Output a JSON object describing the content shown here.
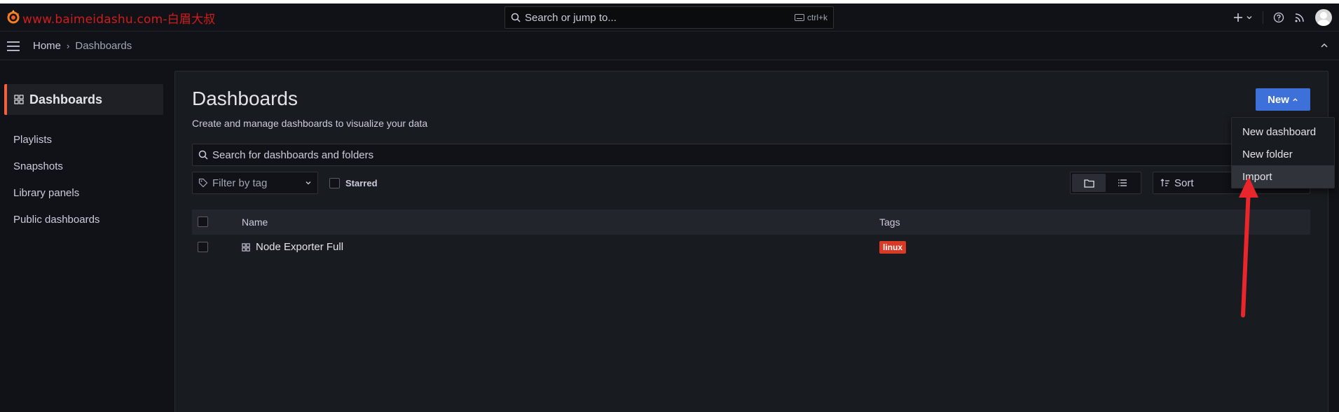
{
  "topbar": {
    "watermark": "www.baimeidashu.com-白眉大叔",
    "search_placeholder": "Search or jump to...",
    "search_shortcut": "ctrl+k",
    "icons": [
      "plus-icon",
      "help-icon",
      "news-rss-icon",
      "user-avatar"
    ]
  },
  "breadcrumb": {
    "home": "Home",
    "separator": "›",
    "current": "Dashboards"
  },
  "sidebar": {
    "active": "Dashboards",
    "items": [
      {
        "label": "Playlists"
      },
      {
        "label": "Snapshots"
      },
      {
        "label": "Library panels"
      },
      {
        "label": "Public dashboards"
      }
    ]
  },
  "page": {
    "title": "Dashboards",
    "subtitle": "Create and manage dashboards to visualize your data",
    "new_button": "New",
    "search_placeholder": "Search for dashboards and folders",
    "filter_placeholder": "Filter by tag",
    "starred_label": "Starred",
    "sort_placeholder": "Sort"
  },
  "table": {
    "columns": [
      "Name",
      "Tags"
    ],
    "rows": [
      {
        "name": "Node Exporter Full",
        "tag": "linux"
      }
    ]
  },
  "new_menu": {
    "items": [
      "New dashboard",
      "New folder",
      "Import"
    ],
    "hovered": "Import"
  },
  "colors": {
    "accent": "#3d71d9",
    "active_bar": "#f55f3e",
    "tag": "#d93a26",
    "arrow": "#e8262b"
  }
}
